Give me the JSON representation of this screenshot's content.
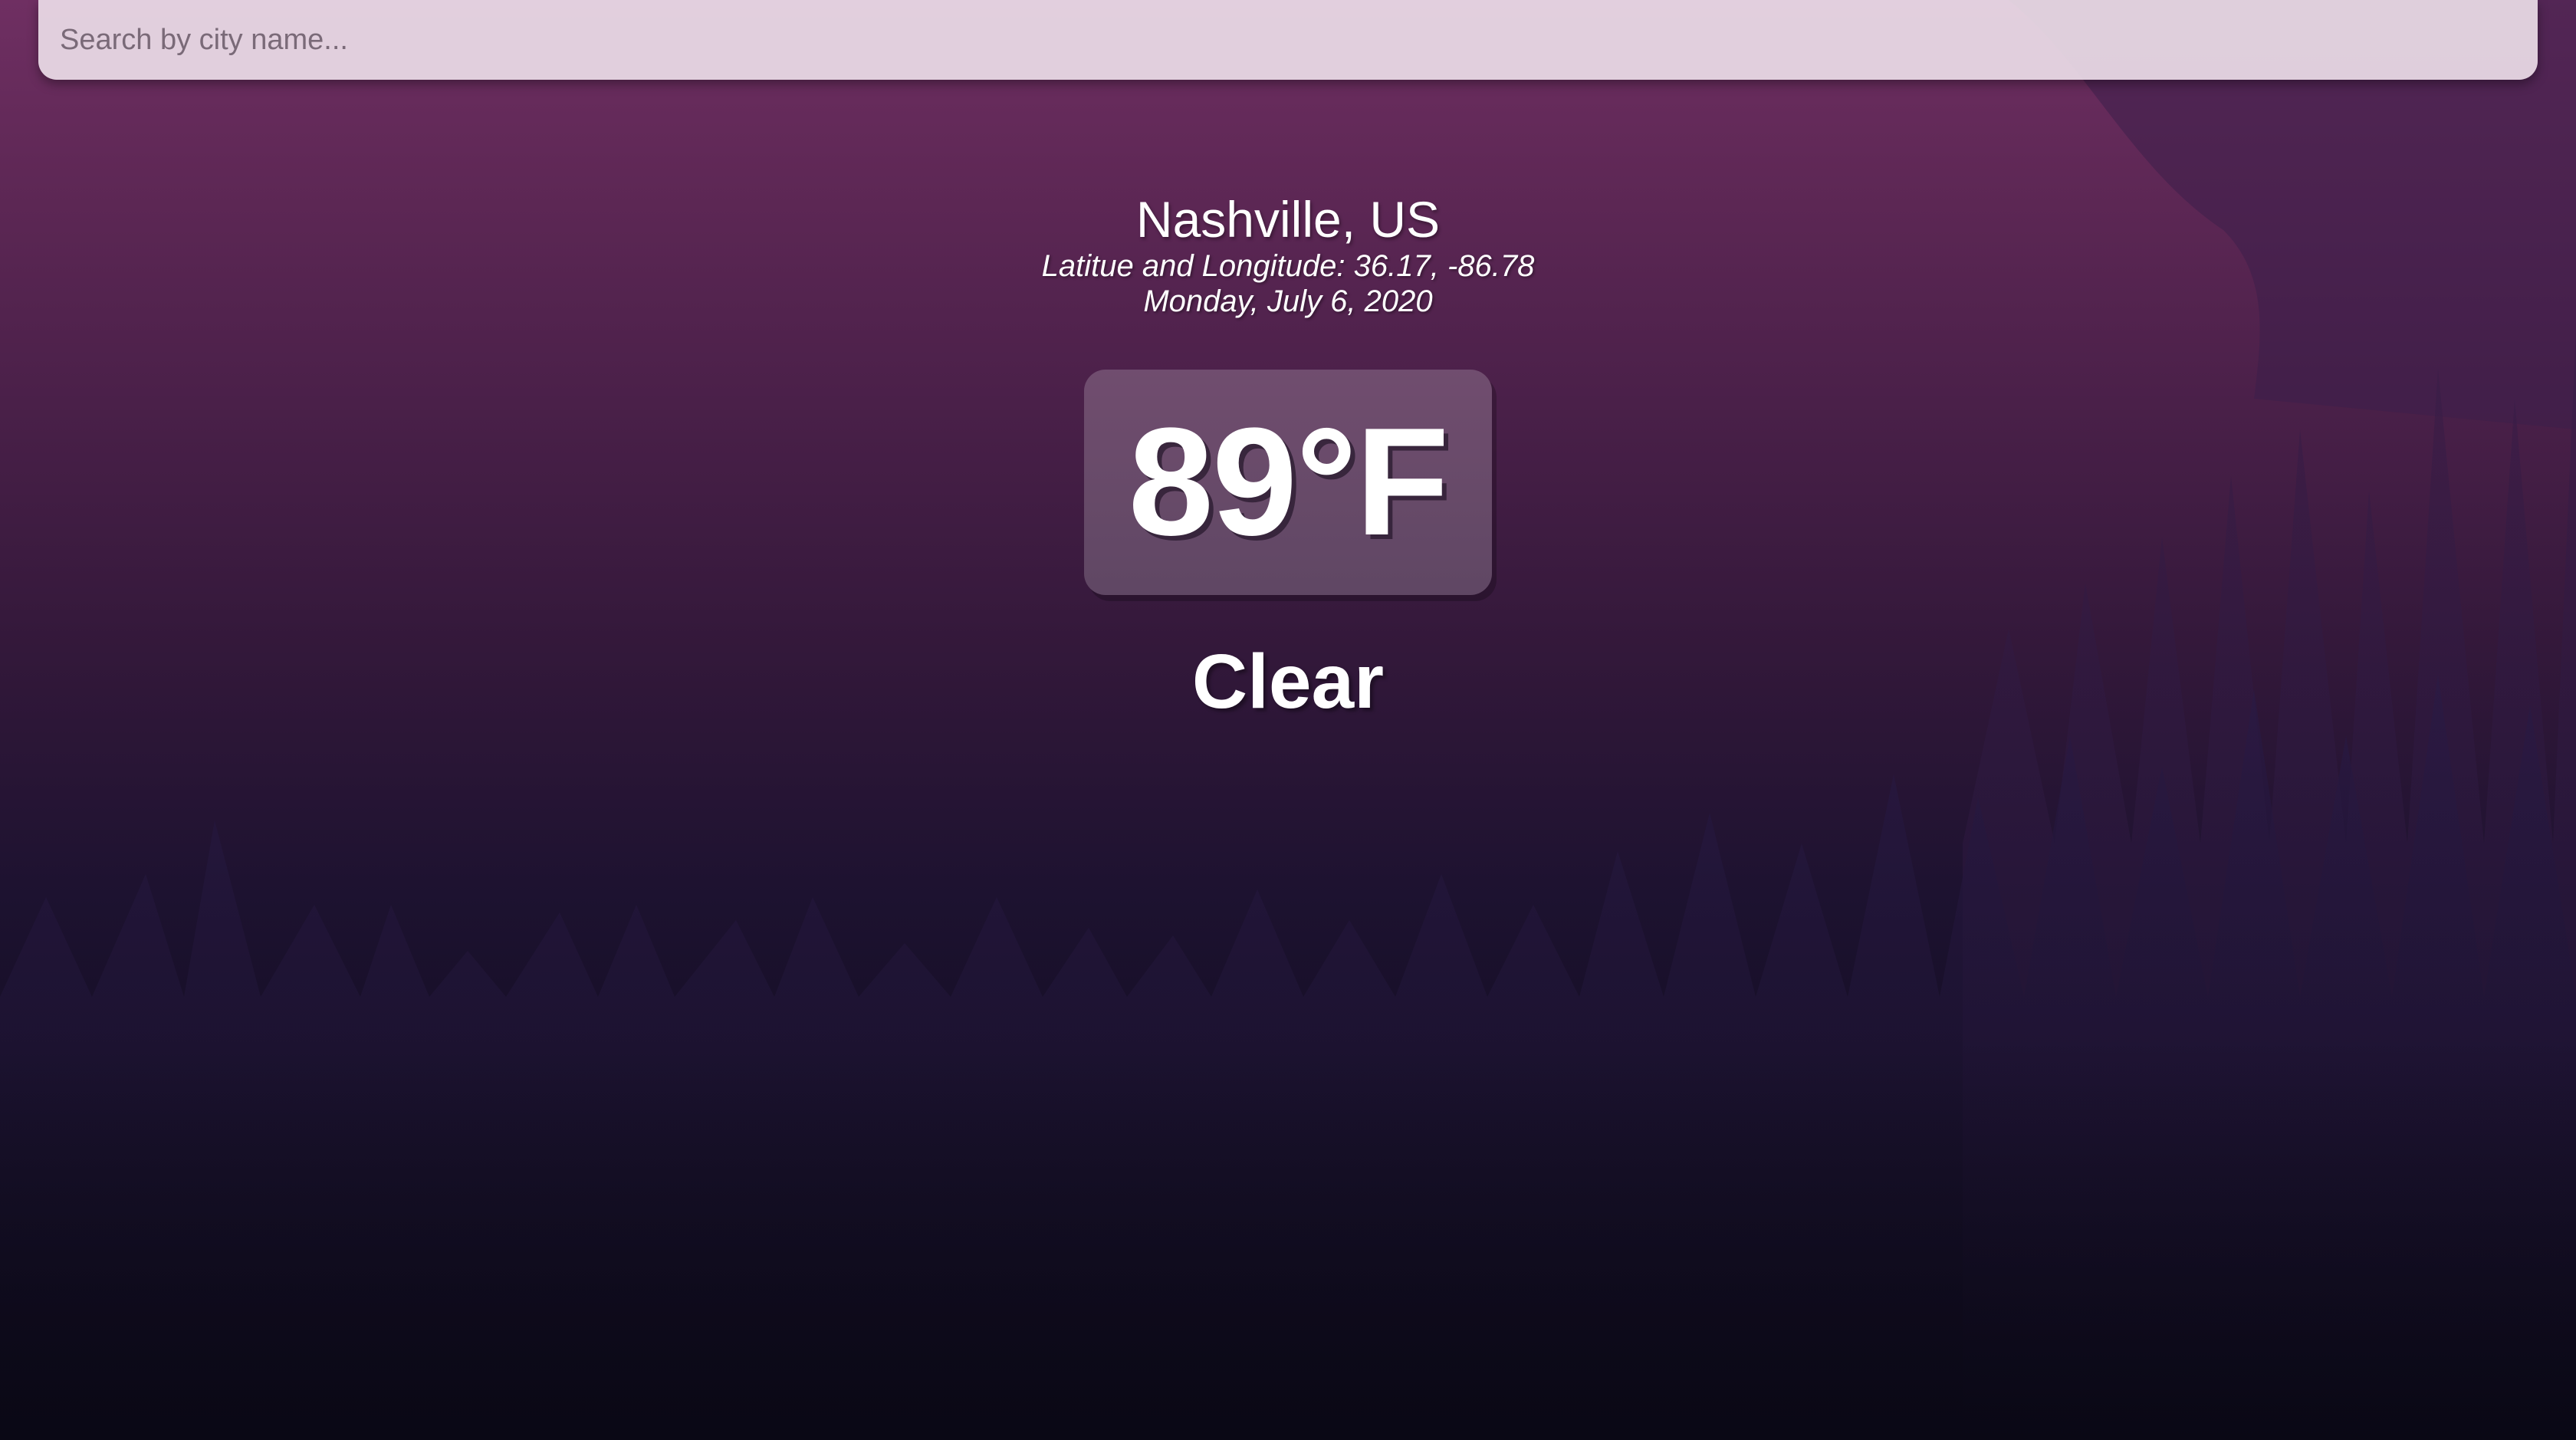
{
  "search": {
    "placeholder": "Search by city name...",
    "value": ""
  },
  "location": {
    "city": "Nashville, US",
    "coords": "Latitue and Longitude: 36.17, -86.78",
    "date": "Monday, July 6, 2020"
  },
  "weather": {
    "temperature": "89°F",
    "condition": "Clear"
  },
  "colors": {
    "background_top": "#6f2f62",
    "background_bottom": "#0c0a18",
    "search_bar": "#ecdde8",
    "text": "#ffffff"
  }
}
